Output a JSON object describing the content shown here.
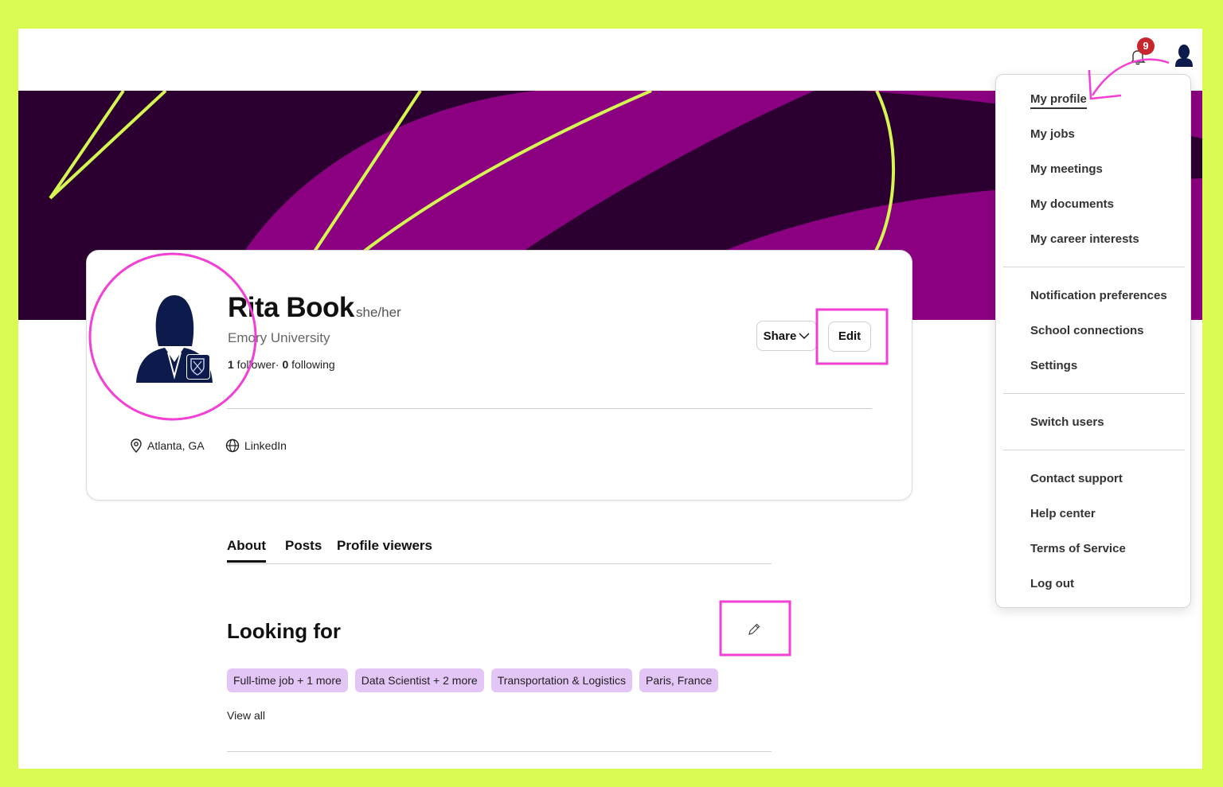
{
  "header": {
    "notification_count": "9",
    "bell_icon": "bell-icon",
    "avatar_icon": "user-avatar-icon"
  },
  "profile": {
    "name": "Rita Book",
    "pronouns": "she/her",
    "school": "Emory University",
    "followers_count": "1",
    "followers_label": " follower· ",
    "following_count": "0",
    "following_label": " following",
    "share_label": "Share",
    "edit_label": "Edit",
    "location": "Atlanta, GA",
    "link": "LinkedIn"
  },
  "tabs": [
    {
      "label": "About",
      "active": true
    },
    {
      "label": "Posts",
      "active": false
    },
    {
      "label": "Profile viewers",
      "active": false
    }
  ],
  "looking_for": {
    "title": "Looking for",
    "tags": [
      "Full-time job + 1 more",
      "Data Scientist + 2 more",
      "Transportation & Logistics",
      "Paris, France"
    ],
    "view_all": "View all"
  },
  "menu": {
    "items": [
      "My profile",
      "My jobs",
      "My meetings",
      "My documents",
      "My career interests",
      "Notification preferences",
      "School connections",
      "Settings",
      "Switch users",
      "Contact support",
      "Help center",
      "Terms of Service",
      "Log out"
    ]
  },
  "colors": {
    "frame_border": "#d9fb52",
    "banner_dark": "#2b0030",
    "banner_purple": "#8b0080",
    "banner_line": "#d4f552",
    "tag_bg": "#e3c6f6",
    "annotation": "#f23fd6",
    "badge": "#c8262e"
  }
}
